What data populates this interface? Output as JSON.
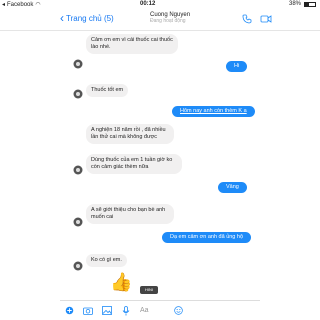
{
  "status_bar": {
    "carrier": "Facebook",
    "time": "00:12",
    "battery": "38%"
  },
  "header": {
    "back_label": "Trang chủ (5)",
    "contact_name": "Cuong Nguyen",
    "contact_status": "Đang hoạt động"
  },
  "messages": [
    {
      "side": "left",
      "text": "Cảm ơn em vì cái thuốc cai thuốc lào nhé."
    },
    {
      "side": "right",
      "text": "Hi"
    },
    {
      "side": "left",
      "text": "Thuốc tốt em"
    },
    {
      "side": "right",
      "text": "Hôm nay anh còn thèm K a"
    },
    {
      "side": "left",
      "text": "A nghiện 18 năm rồi , đã nhiều lần thử cai mà không được"
    },
    {
      "side": "left",
      "text": "Dùng thuốc của em 1 tuần giờ ko còn cảm giác thèm nữa"
    },
    {
      "side": "right",
      "text": "Vâng"
    },
    {
      "side": "left",
      "text": "A sẽ giới thiệu cho bạn bè anh muốn cai"
    },
    {
      "side": "right",
      "text": "Dạ em cảm ơn anh đã ủng hộ"
    },
    {
      "side": "left",
      "text": "Ko có gì em."
    }
  ],
  "composer": {
    "placeholder": "Aa",
    "hint": "HINI"
  },
  "colors": {
    "accent": "#1e8bf8",
    "left_bubble": "#f1f0f0"
  }
}
